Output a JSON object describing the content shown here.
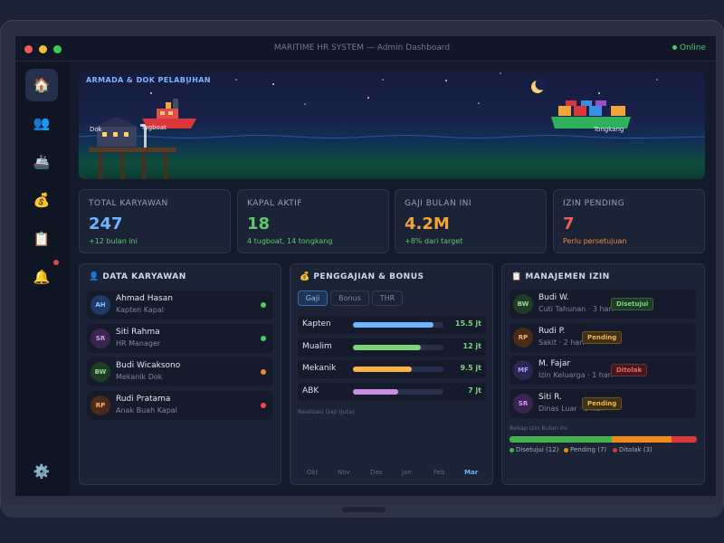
{
  "window": {
    "title": "MARITIME HR SYSTEM — Admin Dashboard",
    "status": "Online"
  },
  "sidebar": {
    "items": [
      {
        "icon": "home-icon",
        "glyph": "🏠",
        "active": true
      },
      {
        "icon": "users-icon",
        "glyph": "👥",
        "active": false
      },
      {
        "icon": "ship-icon",
        "glyph": "🚢",
        "active": false
      },
      {
        "icon": "money-bag-icon",
        "glyph": "💰",
        "active": false
      },
      {
        "icon": "clipboard-icon",
        "glyph": "📋",
        "active": false
      },
      {
        "icon": "bell-icon",
        "glyph": "🔔",
        "active": false
      }
    ],
    "settings_glyph": "⚙️"
  },
  "hero": {
    "title": "ARMADA & DOK PELABUHAN",
    "labels": {
      "dock": "Dok",
      "tugboat": "Tugboat",
      "barge": "Tongkang"
    }
  },
  "stats": [
    {
      "label": "TOTAL KARYAWAN",
      "value": "247",
      "note": "+12 bulan ini",
      "color": "#6fb4ff",
      "note_color": "#5cc86e"
    },
    {
      "label": "KAPAL AKTIF",
      "value": "18",
      "note": "4 tugboat, 14 tongkang",
      "color": "#5cc86e",
      "note_color": "#5cc86e"
    },
    {
      "label": "GAJI BULAN INI",
      "value": "4.2M",
      "note": "+8% dari target",
      "color": "#f2a33a",
      "note_color": "#5cc86e"
    },
    {
      "label": "IZIN PENDING",
      "value": "7",
      "note": "Perlu persetujuan",
      "color": "#ef5a5a",
      "note_color": "#ef8a3a"
    }
  ],
  "employees": {
    "title": "👤 DATA KARYAWAN",
    "items": [
      {
        "initials": "AH",
        "name": "Ahmad Hasan",
        "role": "Kapten Kapal",
        "avatar_bg": "#1f3a66",
        "avatar_fg": "#8fc0ff",
        "status_color": "#4cc86a"
      },
      {
        "initials": "SR",
        "name": "Siti Rahma",
        "role": "HR Manager",
        "avatar_bg": "#3a2450",
        "avatar_fg": "#d49cff",
        "status_color": "#4cc86a"
      },
      {
        "initials": "BW",
        "name": "Budi Wicaksono",
        "role": "Mekanik Dok",
        "avatar_bg": "#203c26",
        "avatar_fg": "#8fe08f",
        "status_color": "#f28a2a"
      },
      {
        "initials": "RP",
        "name": "Rudi Pratama",
        "role": "Anak Buah Kapal",
        "avatar_bg": "#4a2a18",
        "avatar_fg": "#ffb070",
        "status_color": "#ef4a4a"
      }
    ]
  },
  "payroll": {
    "title": "💰 PENGGAJIAN & BONUS",
    "tabs": [
      "Gaji",
      "Bonus",
      "THR"
    ],
    "active_tab": "Gaji",
    "rows": [
      {
        "label": "Kapten",
        "value": "15.5 jt",
        "fraction": 0.89,
        "color": "#6fb4ff"
      },
      {
        "label": "Mualim",
        "value": "12 jt",
        "fraction": 0.75,
        "color": "#7cd67c"
      },
      {
        "label": "Mekanik",
        "value": "9.5 jt",
        "fraction": 0.65,
        "color": "#f7b548"
      },
      {
        "label": "ABK",
        "value": "7 jt",
        "fraction": 0.5,
        "color": "#c88fe0"
      }
    ],
    "chart_caption": "Realisasi Gaji (Juta)",
    "months": [
      "Okt",
      "Nov",
      "Des",
      "Jan",
      "Feb",
      "Mar"
    ],
    "active_month": "Mar"
  },
  "leave": {
    "title": "📋 MANAJEMEN IZIN",
    "items": [
      {
        "initials": "BW",
        "name": "Budi W.",
        "detail": "Cuti Tahunan · 3 hari",
        "status": "Disetujui",
        "avatar_bg": "#203c26",
        "avatar_fg": "#8fe08f",
        "badge_bg": "#1d3b25",
        "badge_fg": "#7cd67c"
      },
      {
        "initials": "RP",
        "name": "Rudi P.",
        "detail": "Sakit · 2 hari",
        "status": "Pending",
        "avatar_bg": "#4a2a18",
        "avatar_fg": "#ffb070",
        "badge_bg": "#3f3116",
        "badge_fg": "#f7b548"
      },
      {
        "initials": "MF",
        "name": "M. Fajar",
        "detail": "Izin Keluarga · 1 hari",
        "status": "Ditolak",
        "avatar_bg": "#2b2752",
        "avatar_fg": "#a9a2ff",
        "badge_bg": "#42191d",
        "badge_fg": "#ef6464"
      },
      {
        "initials": "SR",
        "name": "Siti R.",
        "detail": "Dinas Luar · 5 hari",
        "status": "Pending",
        "avatar_bg": "#3a2450",
        "avatar_fg": "#d49cff",
        "badge_bg": "#3f3116",
        "badge_fg": "#f7b548"
      }
    ],
    "recap_title": "Rekap Izin Bulan Ini",
    "recap": [
      {
        "label": "Disetujui (12)",
        "count": 12,
        "color": "#47b04f"
      },
      {
        "label": "Pending (7)",
        "count": 7,
        "color": "#f08a1c"
      },
      {
        "label": "Ditolak (3)",
        "count": 3,
        "color": "#d9373a"
      }
    ]
  }
}
